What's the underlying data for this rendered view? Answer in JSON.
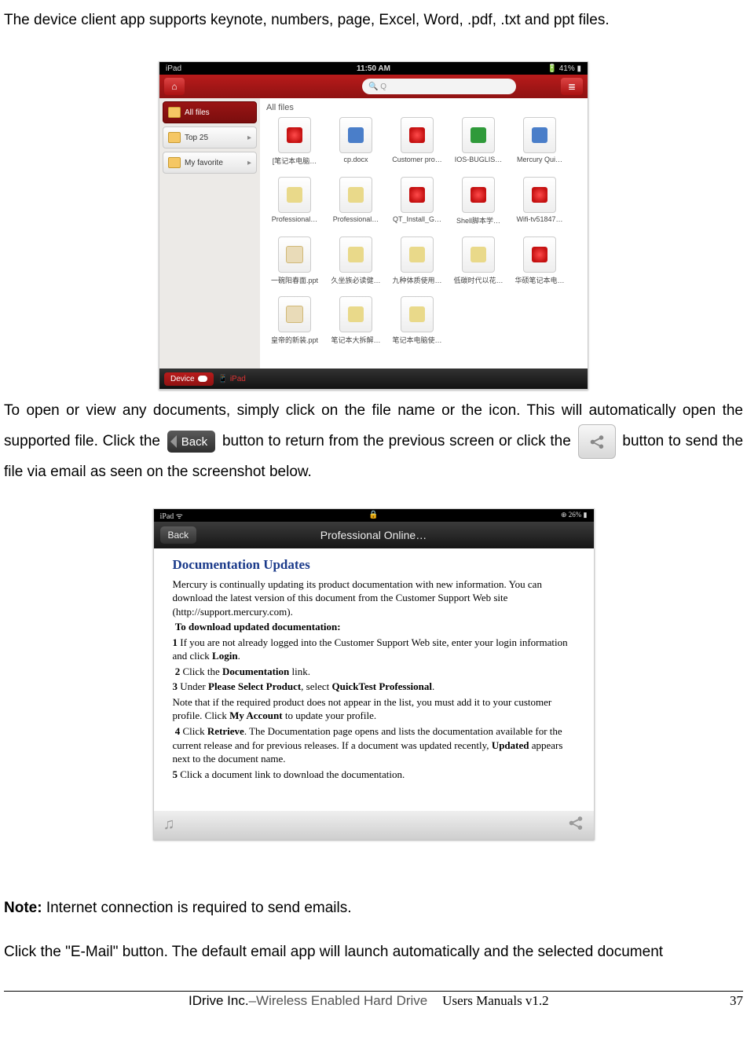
{
  "intro": "The device client app supports keynote, numbers, page, Excel, Word, .pdf, .txt and ppt files.",
  "screenshot1": {
    "status_left": "iPad",
    "status_time": "11:50 AM",
    "status_batt": "41%",
    "search_placeholder": "Q",
    "sidebar": [
      {
        "label": "All files",
        "selected": true
      },
      {
        "label": "Top 25",
        "selected": false
      },
      {
        "label": "My favorite",
        "selected": false
      }
    ],
    "grid_title": "All files",
    "files": [
      {
        "name": "[笔记本电脑…",
        "type": "pdf"
      },
      {
        "name": "cp.docx",
        "type": "doc"
      },
      {
        "name": "Customer pro…",
        "type": "pdf"
      },
      {
        "name": "IOS-BUGLIS…",
        "type": "xls"
      },
      {
        "name": "Mercury  Qui…",
        "type": "doc"
      },
      {
        "name": "Professional…",
        "type": "txt"
      },
      {
        "name": "Professional…",
        "type": "txt"
      },
      {
        "name": "QT_Install_G…",
        "type": "pdf"
      },
      {
        "name": "Shell脚本学…",
        "type": "pdf"
      },
      {
        "name": "Wifi-tv51847…",
        "type": "pdf"
      },
      {
        "name": "一碗阳春面.ppt",
        "type": "ppt"
      },
      {
        "name": "久坐族必读健…",
        "type": "txt"
      },
      {
        "name": "九种体质使用…",
        "type": "txt"
      },
      {
        "name": "低碳时代以花…",
        "type": "txt"
      },
      {
        "name": "华硕笔记本电…",
        "type": "pdf"
      },
      {
        "name": "皇帝的新装.ppt",
        "type": "ppt"
      },
      {
        "name": "笔记本大拆解…",
        "type": "txt"
      },
      {
        "name": "笔记本电脑使…",
        "type": "txt"
      }
    ],
    "bottom_device": "Device",
    "bottom_ipad": "iPad"
  },
  "para2a": "To open or view any documents, simply click on the file name or the icon.   This will automatically open the supported file.   Click the ",
  "back_label": "Back",
  "para2b": " button to return from the previous screen or click the ",
  "para2c": " button to send the file via email as seen on the screenshot below.",
  "screenshot2": {
    "status_left": "iPad",
    "status_batt": "26%",
    "back": "Back",
    "title": "Professional Online…",
    "heading": "Documentation Updates",
    "p1": "Mercury is continually updating its product documentation with new information. You can download the latest version of this document from the Customer Support Web  site (http://support.mercury.com).",
    "sub": "To download updated documentation:",
    "s1a": "1",
    "s1b": "  If you are not already logged into the  Customer Support Web site, enter your login information and click ",
    "s1c": "Login",
    "period": ".",
    "s2a": "2",
    "s2b": "   Click   the   ",
    "s2c": "Documentation",
    "s2d": " link.",
    "s3a": "3",
    "s3b": "  Under ",
    "s3c": "Please Select Product",
    "s3d": ", select  ",
    "s3e": "QuickTest Professional",
    "note_a": "Note   that if the   required product does   not appear in the list, you must add   it to your   customer profile. Click ",
    "note_b": "My Account",
    "note_c": " to update your   profile.",
    "s4a": "4",
    "s4b": "  Click ",
    "s4c": "Retrieve",
    "s4d": ". The Documentation page   opens and lists the   documentation available for the   current release   and for previous releases. If a document was updated recently, ",
    "s4e": "Updated",
    "s4f": " appears next to the document name.",
    "s5a": "5",
    "s5b": "  Click a document link   to download the   documentation."
  },
  "note_label": "Note:",
  "note_text": " Internet connection is required to send emails.",
  "para4": "Click the \"E-Mail\" button. The default email app will launch automatically and the selected document",
  "footer_company": "IDrive Inc.",
  "footer_prod": "–Wireless Enabled Hard Drive",
  "footer_man": "Users Manuals v1.2",
  "page_no": "37"
}
